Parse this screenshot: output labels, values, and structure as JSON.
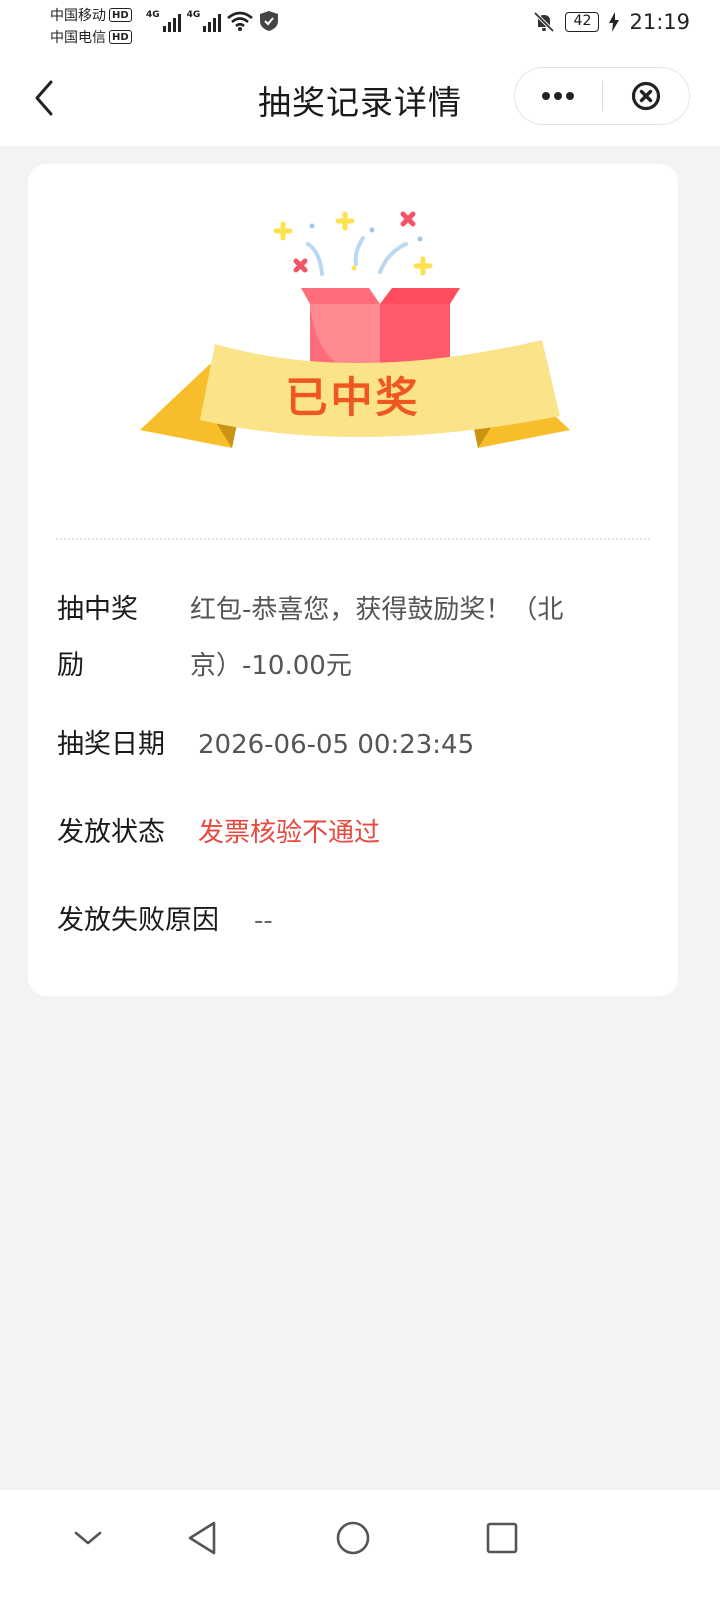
{
  "status_bar": {
    "carriers": [
      {
        "name": "中国移动",
        "badge": "HD"
      },
      {
        "name": "中国电信",
        "badge": "HD"
      }
    ],
    "signal_tech": [
      "4G",
      "4G"
    ],
    "battery": "42",
    "time": "21:19"
  },
  "nav": {
    "title": "抽奖记录详情"
  },
  "prize": {
    "banner_text": "已中奖",
    "colors": {
      "ribbon": "#fbe38a",
      "ribbon_tail": "#f5bd2a",
      "box": "#ff5a6a",
      "banner_text": "#f0561f"
    }
  },
  "details": {
    "reward_label": "抽中奖励",
    "reward_value": "红包-恭喜您，获得鼓励奖！（北京）-10.00元",
    "date_label": "抽奖日期",
    "date_value": "2026-06-05 00:23:45",
    "status_label": "发放状态",
    "status_value": "发票核验不通过",
    "reason_label": "发放失败原因",
    "reason_value": "--"
  },
  "icons": [
    "wifi-icon",
    "shield-icon",
    "bell-off-icon",
    "charging-icon",
    "back-arrow-icon",
    "more-dots-icon",
    "close-circle-icon",
    "collapse-icon",
    "back-triangle-icon",
    "home-circle-icon",
    "recents-square-icon"
  ]
}
